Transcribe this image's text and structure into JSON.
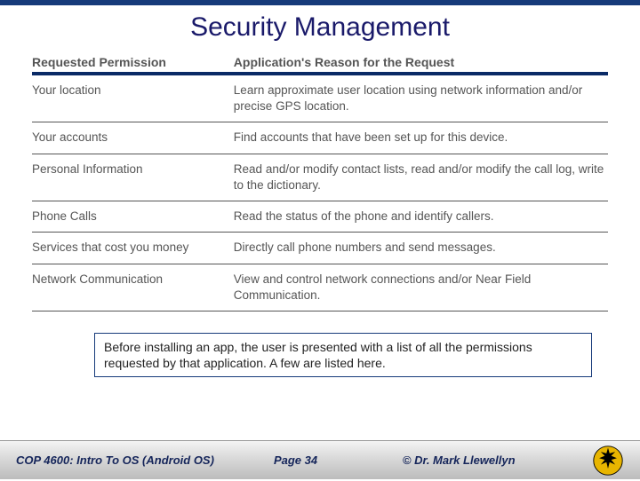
{
  "title": "Security Management",
  "table": {
    "header_permission": "Requested Permission",
    "header_reason": "Application's Reason for the Request",
    "rows": [
      {
        "permission": "Your location",
        "reason": "Learn approximate user location using network information and/or precise GPS location."
      },
      {
        "permission": "Your accounts",
        "reason": "Find accounts that have been set up for this device."
      },
      {
        "permission": "Personal Information",
        "reason": "Read and/or modify contact lists, read and/or modify the call log, write to the dictionary."
      },
      {
        "permission": "Phone Calls",
        "reason": "Read the status of the phone and identify callers."
      },
      {
        "permission": "Services that cost you money",
        "reason": "Directly call phone numbers and send messages."
      },
      {
        "permission": "Network Communication",
        "reason": "View and control network connections and/or Near Field Communication."
      }
    ]
  },
  "caption": "Before installing an app, the user is presented with a list of all the permissions requested by that application. A few are listed here.",
  "footer": {
    "course": "COP 4600: Intro To OS  (Android OS)",
    "page": "Page 34",
    "copyright": "© Dr. Mark Llewellyn"
  }
}
